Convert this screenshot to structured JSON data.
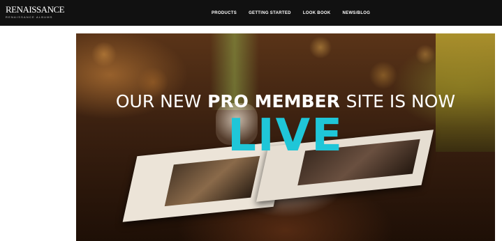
{
  "logo": {
    "name": "RENAISSANCE",
    "tagline": "RENAISSANCE ALBUMS"
  },
  "nav": {
    "items": [
      "PRODUCTS",
      "GETTING STARTED",
      "LOOK BOOK",
      "NEWS/BLOG"
    ]
  },
  "hero": {
    "line_prefix": "OUR NEW",
    "line_emphasis": "PRO MEMBER",
    "line_suffix": "SITE IS NOW",
    "live": "LIVE",
    "live_color": "#1fc6d8"
  },
  "colors": {
    "topbar": "#111111",
    "page_background": "#ffffff"
  }
}
